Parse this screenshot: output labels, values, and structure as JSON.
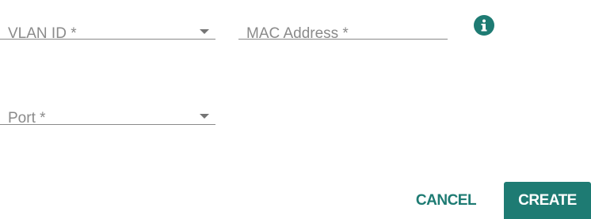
{
  "form": {
    "vlan_id": {
      "label": "VLAN ID *",
      "value": ""
    },
    "mac_address": {
      "label": "MAC Address *",
      "value": ""
    },
    "port": {
      "label": "Port *",
      "value": ""
    }
  },
  "info_icon": {
    "icon": "info-icon",
    "color": "#1e7b73"
  },
  "actions": {
    "cancel_label": "CANCEL",
    "create_label": "CREATE"
  },
  "colors": {
    "accent": "#1e7b73",
    "label_text": "#8a8a8a",
    "underline": "#8a8a8a"
  }
}
